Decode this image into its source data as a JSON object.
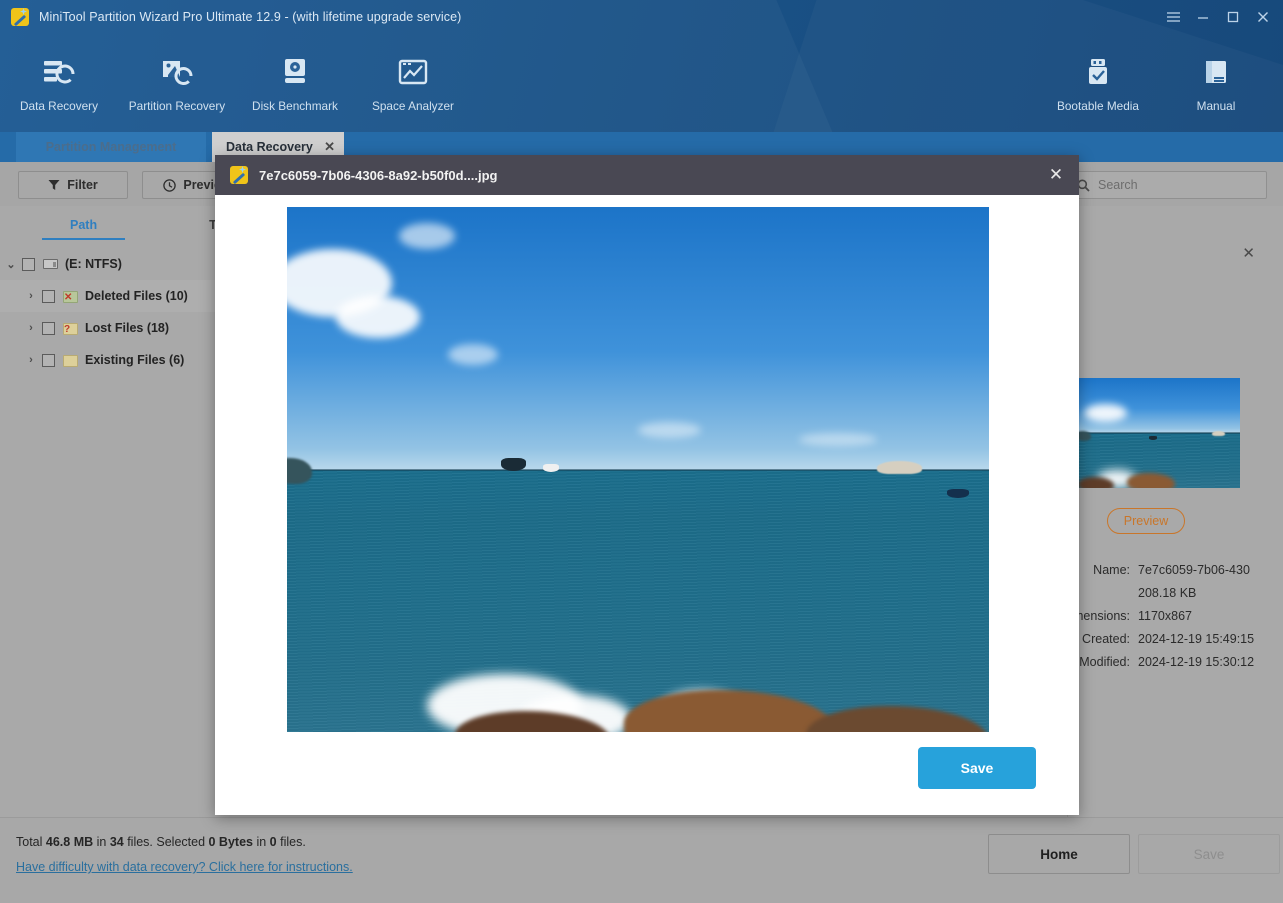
{
  "window": {
    "title": "MiniTool Partition Wizard Pro Ultimate 12.9 - (with lifetime upgrade service)",
    "menu_icon": "hamburger-icon",
    "minimize_icon": "minimize-icon",
    "maximize_icon": "maximize-icon",
    "close_icon": "close-icon"
  },
  "toolbar": {
    "left_tools": [
      {
        "label": "Data Recovery",
        "icon": "data-recovery-icon"
      },
      {
        "label": "Partition Recovery",
        "icon": "partition-recovery-icon"
      },
      {
        "label": "Disk Benchmark",
        "icon": "disk-benchmark-icon"
      },
      {
        "label": "Space Analyzer",
        "icon": "space-analyzer-icon"
      }
    ],
    "right_tools": [
      {
        "label": "Bootable Media",
        "icon": "bootable-media-icon"
      },
      {
        "label": "Manual",
        "icon": "manual-book-icon"
      }
    ]
  },
  "tabs": [
    {
      "label": "Partition Management",
      "active": false,
      "closable": false
    },
    {
      "label": "Data Recovery",
      "active": true,
      "closable": true,
      "close_glyph": "✕"
    }
  ],
  "commandbar": {
    "filter_label": "Filter",
    "filter_icon": "funnel-icon",
    "preview_label": "Preview",
    "preview_icon": "eye-clock-icon",
    "search_placeholder": "Search",
    "search_value": "",
    "search_icon": "search-icon"
  },
  "file_list": {
    "columns": [
      "Path",
      "Type"
    ],
    "active_column": "Path",
    "tree": [
      {
        "label": "(E: NTFS)",
        "icon": "drive-icon",
        "expanded": true,
        "twisty": "⌄",
        "depth": 0,
        "checked": false
      },
      {
        "label": "Deleted Files (10)",
        "icon": "deleted-folder-icon",
        "expanded": false,
        "twisty": "›",
        "depth": 1,
        "checked": false,
        "highlighted": true
      },
      {
        "label": "Lost Files (18)",
        "icon": "lost-folder-icon",
        "expanded": false,
        "twisty": "›",
        "depth": 1,
        "checked": false
      },
      {
        "label": "Existing Files (6)",
        "icon": "existing-folder-icon",
        "expanded": false,
        "twisty": "›",
        "depth": 1,
        "checked": false
      }
    ]
  },
  "details_panel": {
    "close_glyph": "✕",
    "thumbnail_alt": "seascape-thumbnail",
    "preview_button": "Preview",
    "rows": [
      {
        "label": "Name:",
        "value": "7e7c6059-7b06-430"
      },
      {
        "label": "",
        "value": "208.18 KB"
      },
      {
        "label": "Dimensions:",
        "value": "1170x867"
      },
      {
        "label": "Created:",
        "value": "2024-12-19 15:49:15"
      },
      {
        "label": "Modified:",
        "value": "2024-12-19 15:30:12"
      }
    ]
  },
  "footer": {
    "status_prefix": "Total ",
    "status_total_size": "46.8 MB",
    "status_mid": " in ",
    "status_total_files": "34",
    "status_mid2": " files.  Selected ",
    "status_selected_size": "0 Bytes",
    "status_mid3": " in ",
    "status_selected_files": "0",
    "status_suffix": " files.",
    "help_link": "Have difficulty with data recovery? Click here for instructions.",
    "home_button": "Home",
    "save_button": "Save",
    "save_disabled": true
  },
  "modal": {
    "title": "7e7c6059-7b06-4306-8a92-b50f0d....jpg",
    "icon": "app-logo-icon",
    "close_glyph": "✕",
    "save_button": "Save",
    "image_alt": "seascape-preview-image"
  },
  "colors": {
    "header_blue": "#1a5287",
    "tab_active_bg": "#cfcfcf",
    "modal_header": "#494853",
    "accent_blue": "#27a2db",
    "link_blue": "#2a6f9e",
    "preview_orange": "#c9762a",
    "panel_gray": "#a8a8a8"
  }
}
